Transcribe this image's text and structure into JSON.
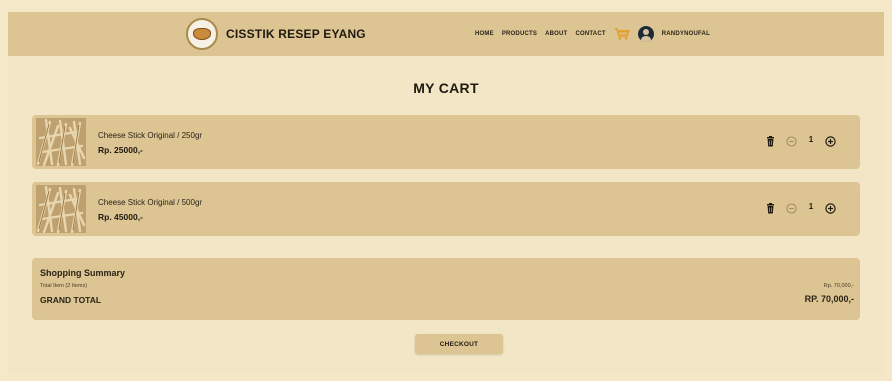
{
  "brand": {
    "name": "CISSTIK RESEP EYANG",
    "logo_icon": "logo-icon"
  },
  "nav": {
    "links": [
      {
        "label": "HOME"
      },
      {
        "label": "PRODUCTS"
      },
      {
        "label": "ABOUT"
      },
      {
        "label": "CONTACT"
      }
    ],
    "cart_icon": "cart-icon",
    "username": "RANDYNOUFAL"
  },
  "page": {
    "title": "MY CART"
  },
  "cart": {
    "items": [
      {
        "name": "Cheese Stick Original / 250gr",
        "price": "Rp. 25000,-",
        "qty": "1"
      },
      {
        "name": "Cheese Stick Original / 500gr",
        "price": "Rp. 45000,-",
        "qty": "1"
      }
    ]
  },
  "summary": {
    "title": "Shopping Summary",
    "total_label": "Total Item (2 Items)",
    "total_value": "Rp. 70,000,-",
    "grand_label": "GRAND TOTAL",
    "grand_value": "RP. 70,000,-"
  },
  "checkout": {
    "label": "CHECKOUT"
  },
  "colors": {
    "background": "#f2e6c6",
    "panel": "#dcc493",
    "text": "#1f1a10"
  }
}
